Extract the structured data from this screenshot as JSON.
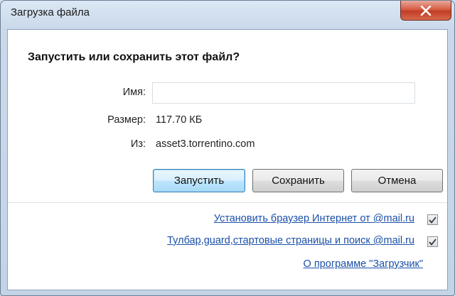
{
  "window": {
    "title": "Загрузка файла"
  },
  "dialog": {
    "question": "Запустить или сохранить этот файл?",
    "name_label": "Имя:",
    "name_value": "",
    "size_label": "Размер:",
    "size_value": "117.70 КБ",
    "from_label": "Из:",
    "from_value": "asset3.torrentino.com"
  },
  "buttons": {
    "run": "Запустить",
    "save": "Сохранить",
    "cancel": "Отмена"
  },
  "options": [
    {
      "label": "Установить браузер Интернет от @mail.ru",
      "checked": true
    },
    {
      "label": "Тулбар,guard,стартовые страницы и поиск @mail.ru",
      "checked": true
    }
  ],
  "about_link": "О программе \"Загрузчик\"",
  "icons": {
    "close": "close-icon",
    "check": "checkmark-icon"
  }
}
